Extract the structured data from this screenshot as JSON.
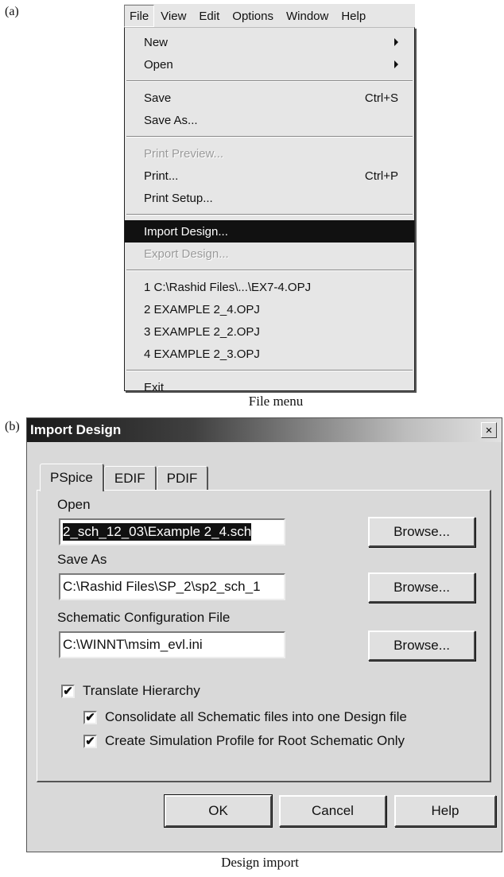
{
  "figure": {
    "label_a": "(a)",
    "label_b": "(b)",
    "caption_a": "File menu",
    "caption_b": "Design import"
  },
  "menubar": {
    "items": [
      "File",
      "View",
      "Edit",
      "Options",
      "Window",
      "Help"
    ],
    "active": "File"
  },
  "file_menu": {
    "new": "New",
    "open": "Open",
    "save": "Save",
    "save_shortcut": "Ctrl+S",
    "save_as": "Save As...",
    "print_preview": "Print Preview...",
    "print": "Print...",
    "print_shortcut": "Ctrl+P",
    "print_setup": "Print Setup...",
    "import_design": "Import Design...",
    "export_design": "Export Design...",
    "recent": [
      "1 C:\\Rashid Files\\...\\EX7-4.OPJ",
      "2 EXAMPLE 2_4.OPJ",
      "3 EXAMPLE 2_2.OPJ",
      "4 EXAMPLE 2_3.OPJ"
    ],
    "exit": "Exit"
  },
  "dialog": {
    "title": "Import Design",
    "close_glyph": "×",
    "tabs": [
      "PSpice",
      "EDIF",
      "PDIF"
    ],
    "active_tab": "PSpice",
    "open_label": "Open",
    "open_value": "2_sch_12_03\\Example 2_4.sch",
    "save_as_label": "Save As",
    "save_as_value": "C:\\Rashid Files\\SP_2\\sp2_sch_1",
    "config_label": "Schematic Configuration File",
    "config_value": "C:\\WINNT\\msim_evl.ini",
    "browse_label": "Browse...",
    "check_translate": "Translate Hierarchy",
    "check_consolidate": "Consolidate all Schematic files into one Design file",
    "check_profile": "Create Simulation Profile for Root Schematic Only",
    "checked_glyph": "✔",
    "ok_label": "OK",
    "cancel_label": "Cancel",
    "help_label": "Help"
  }
}
